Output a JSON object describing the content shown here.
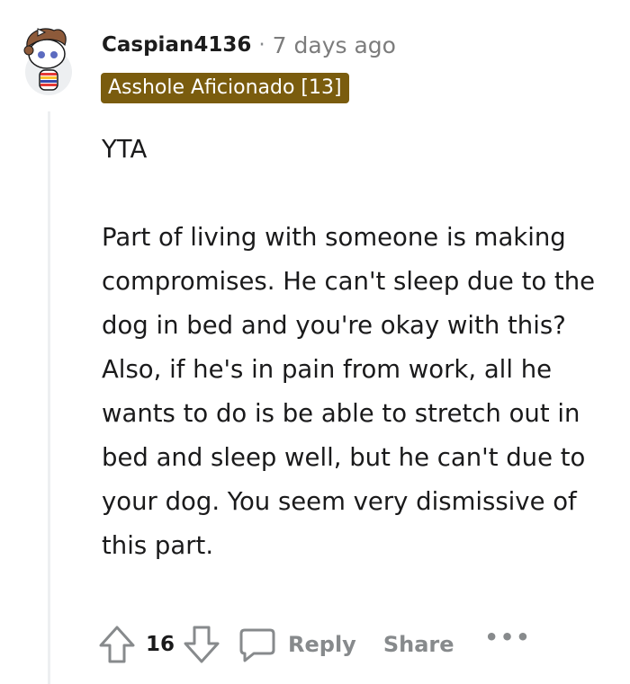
{
  "comment": {
    "author": "Caspian4136",
    "separator": "·",
    "timestamp": "7 days ago",
    "flair": "Asshole Aficionado [13]",
    "body": {
      "verdict": "YTA",
      "paragraph": "Part of living with someone is making compromises. He can't sleep due to the dog in bed and you're okay with this? Also, if he's in pain from work, all he wants to do is be able to stretch out in bed and sleep well, but he can't due to your dog. You seem very dismissive of this part."
    },
    "actions": {
      "vote_count": "16",
      "reply_label": "Reply",
      "share_label": "Share",
      "more_label": "•••"
    }
  },
  "colors": {
    "flair_bg": "#7a5c0e",
    "muted_text": "#878a8c",
    "thread_line": "#edeff1"
  }
}
